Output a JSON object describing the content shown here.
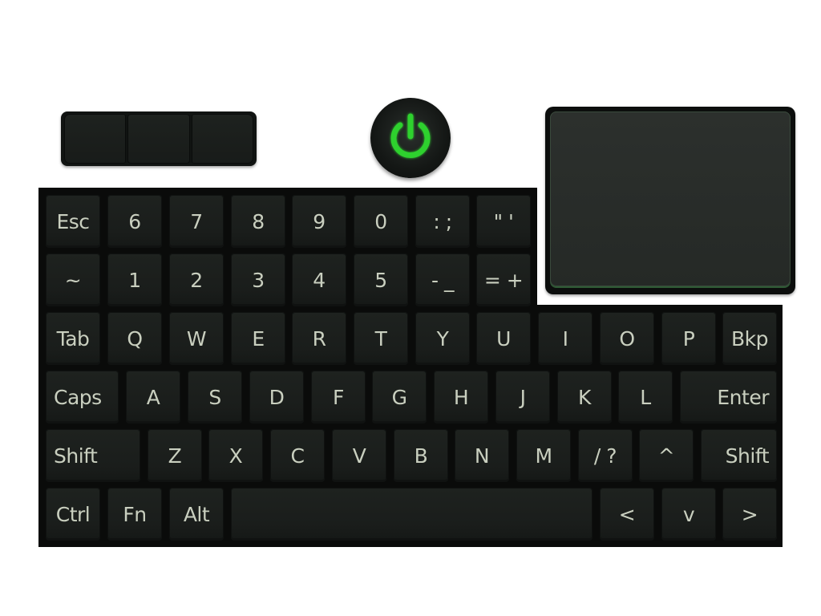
{
  "power": {
    "icon": "power-icon",
    "accent": "#2fd12f"
  },
  "touchpad": {
    "border_color": "#2f5a35"
  },
  "keyboard": {
    "rows": [
      [
        "Esc",
        "6",
        "7",
        "8",
        "9",
        "0",
        ": ;",
        "\" '"
      ],
      [
        "~",
        "1",
        "2",
        "3",
        "4",
        "5",
        "- _",
        "= +"
      ],
      [
        "Tab",
        "Q",
        "W",
        "E",
        "R",
        "T",
        "Y",
        "U",
        "I",
        "O",
        "P",
        "Bkp"
      ],
      [
        "Caps",
        "A",
        "S",
        "D",
        "F",
        "G",
        "H",
        "J",
        "K",
        "L",
        "Enter"
      ],
      [
        "Shift",
        "Z",
        "X",
        "C",
        "V",
        "B",
        "N",
        "M",
        "/ ?",
        "^",
        "Shift"
      ],
      [
        "Ctrl",
        "Fn",
        "Alt",
        "",
        "<",
        "v",
        ">"
      ]
    ]
  }
}
